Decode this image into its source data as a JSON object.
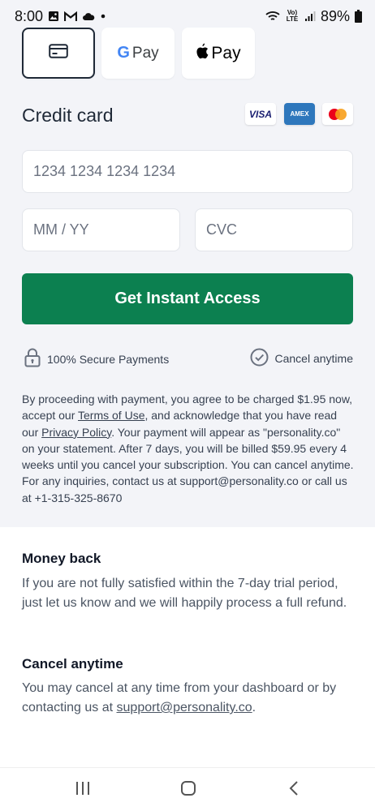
{
  "status_bar": {
    "time": "8:00",
    "battery": "89%",
    "network_label": "Vo) LTE",
    "icons": [
      "gallery-icon",
      "gmail-icon",
      "cloud-icon",
      "dot-icon",
      "wifi-icon",
      "signal-icon",
      "battery-icon"
    ]
  },
  "payment_methods": {
    "card_icon": "credit-card-icon",
    "gpay_label": "Pay",
    "gpay_letter": "G",
    "apple_label": "Pay"
  },
  "credit_card": {
    "title": "Credit card",
    "brands": {
      "visa": "VISA",
      "amex": "AMEX"
    },
    "card_number_placeholder": "1234 1234 1234 1234",
    "expiry_placeholder": "MM / YY",
    "cvc_placeholder": "CVC"
  },
  "cta": {
    "label": "Get Instant Access",
    "color": "#0c8050"
  },
  "trust": {
    "secure_label": "100% Secure Payments",
    "cancel_label": "Cancel anytime"
  },
  "legal": {
    "part1": "By proceeding with payment, you agree to be charged $1.95 now, accept our ",
    "terms_link": "Terms of Use",
    "part2": ", and acknowledge that you have read our ",
    "privacy_link": "Privacy Policy",
    "part3": ". Your payment will appear as \"personality.co\" on your statement. After 7 days, you will be billed $59.95 every 4 weeks until you cancel your subscription. You can cancel anytime. For any inquiries, contact us at support@personality.co or call us at +1-315-325-8670"
  },
  "money_back": {
    "heading": "Money back",
    "text": "If you are not fully satisfied within the 7-day trial period, just let us know and we will happily process a full refund."
  },
  "cancel_info": {
    "heading": "Cancel anytime",
    "text_prefix": "You may cancel at any time from your dashboard or by contacting us at ",
    "email_link": "support@personality.co",
    "text_suffix": "."
  }
}
